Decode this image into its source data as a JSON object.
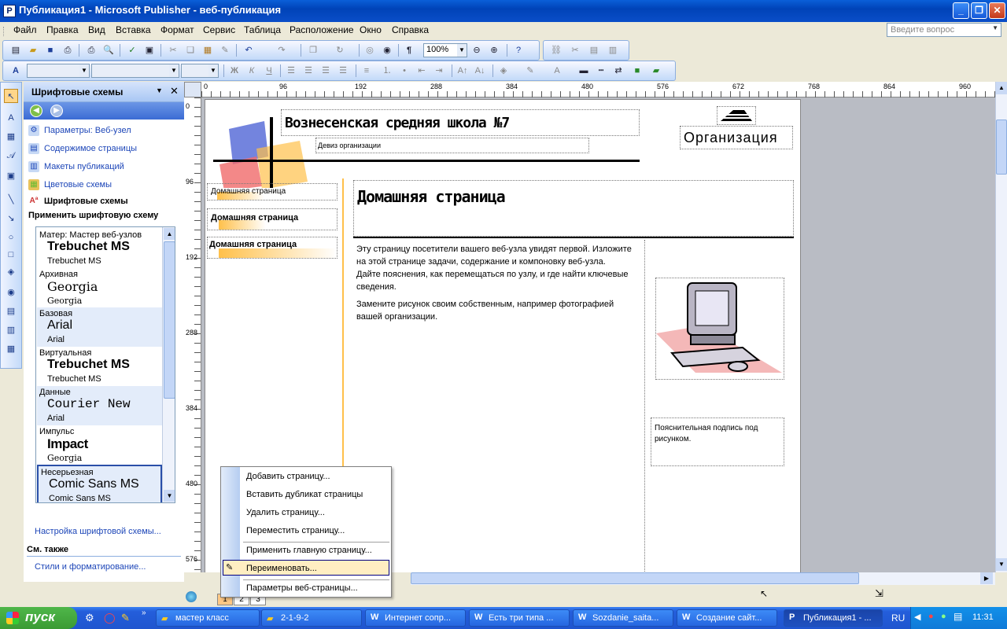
{
  "window": {
    "title": "Публикация1 - Microsoft Publisher - веб-публикация",
    "icon": "publisher-icon"
  },
  "menu": [
    "Файл",
    "Правка",
    "Вид",
    "Вставка",
    "Формат",
    "Сервис",
    "Таблица",
    "Расположение",
    "Окно",
    "Справка"
  ],
  "ask_placeholder": "Введите вопрос",
  "toolbar": {
    "zoom": "100%",
    "para_mark": "¶",
    "bold": "Ж",
    "italic": "К",
    "underline": "Ч"
  },
  "taskpane": {
    "title": "Шрифтовые схемы",
    "links": [
      "Параметры: Веб-узел",
      "Содержимое страницы",
      "Макеты публикаций",
      "Цветовые схемы",
      "Шрифтовые схемы"
    ],
    "apply_label": "Применить шрифтовую схему",
    "schemes": [
      {
        "cat": "Матер: Мастер веб-узлов",
        "big": "Trebuchet MS",
        "small": "Trebuchet MS"
      },
      {
        "cat": "Архивная",
        "big": "Georgia",
        "small": "Georgia"
      },
      {
        "cat": "Базовая",
        "big": "Arial",
        "small": "Arial"
      },
      {
        "cat": "Виртуальная",
        "big": "Trebuchet MS",
        "small": "Trebuchet MS"
      },
      {
        "cat": "Данные",
        "big": "Courier New",
        "small": "Arial"
      },
      {
        "cat": "Импульс",
        "big": "Impact",
        "small": "Georgia"
      },
      {
        "cat": "Несерьезная",
        "big": "Comic Sans MS",
        "small": "Comic Sans MS"
      }
    ],
    "settings_link": "Настройка шрифтовой схемы...",
    "see_also": "См. также",
    "styles_link": "Стили и форматирование..."
  },
  "ruler_top": [
    "0",
    "96",
    "192",
    "288",
    "384",
    "480",
    "576",
    "672",
    "768",
    "864",
    "960"
  ],
  "ruler_left": [
    "0",
    "96",
    "192",
    "288",
    "384",
    "480",
    "576"
  ],
  "document": {
    "school_name": "Вознесенская средняя школа №7",
    "motto": "Девиз организации",
    "org": "Организация",
    "nav": [
      "Домашняя страница",
      "Домашняя страница",
      "Домашняя страница"
    ],
    "heading": "Домашняя страница",
    "para1": "Эту страницу посетители вашего веб-узла увидят первой. Изложите на этой странице задачи, содержание и компоновку веб-узла. Дайте пояснения, как перемещаться по узлу, и где найти ключевые сведения.",
    "para2": "Замените рисунок своим собственным, например фотографией вашей организации.",
    "caption": "Пояснительная подпись под рисунком."
  },
  "context_menu": [
    "Добавить страницу...",
    "Вставить дубликат страницы",
    "Удалить страницу...",
    "Переместить страницу...",
    "Применить главную страницу...",
    "Переименовать...",
    "Параметры веб-страницы..."
  ],
  "page_tabs": [
    "1",
    "2",
    "3"
  ],
  "taskbar": {
    "start": "пуск",
    "tasks": [
      "мастер класс",
      "2-1-9-2",
      "Интернет сопр...",
      "Есть три типа ...",
      "Sozdanie_saita...",
      "Создание сайт...",
      "Публикация1 - ..."
    ],
    "lang": "RU",
    "time": "11:31"
  }
}
